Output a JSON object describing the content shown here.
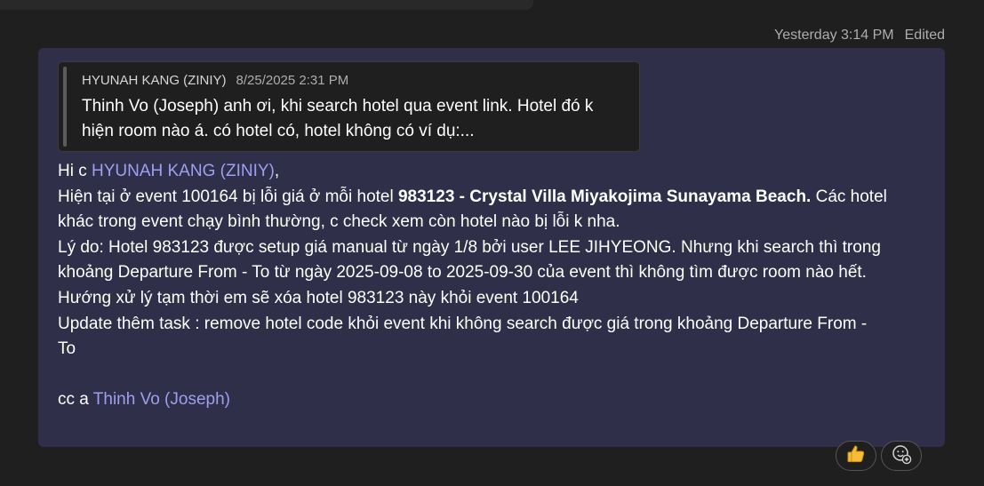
{
  "header": {
    "timestamp": "Yesterday 3:14 PM",
    "edited": "Edited"
  },
  "quote": {
    "author": "HYUNAH KANG (ZINIY)",
    "time": "8/25/2025 2:31 PM",
    "text_line1": "Thinh Vo (Joseph) anh ơi, khi search hotel qua event link. Hotel đó k",
    "text_line2": "hiện room nào á. có hotel có, hotel không có ví dụ:..."
  },
  "message": {
    "greeting_prefix": "Hi c ",
    "greeting_mention": "HYUNAH KANG (ZINIY)",
    "greeting_suffix": ",",
    "l2_text": "Hiện tại ở event 100164 bị lỗi giá ở mỗi hotel ",
    "l2_bold": "983123 - Crystal Villa Miyakojima Sunayama Beach.",
    "l2_rest": " Các hotel",
    "l3": "khác trong event chạy bình thường, c check xem còn hotel nào bị lỗi k nha.",
    "l4": "Lý do: Hotel 983123 được setup giá manual từ ngày 1/8 bởi user LEE JIHYEONG. Nhưng khi search thì trong",
    "l5": "khoảng Departure From - To từ ngày 2025-09-08 to 2025-09-30 của event thì không tìm được room nào hết.",
    "l6": "Hướng xử lý tạm thời em sẽ xóa hotel 983123 này khỏi event 100164",
    "l7": "Update thêm task : remove hotel code khỏi event khi không search được giá trong khoảng Departure From -",
    "l8": "To",
    "cc_prefix": "cc a ",
    "cc_mention": "Thinh Vo (Joseph)"
  },
  "reactions": {
    "like_icon": "thumbs-up-icon",
    "add_icon": "add-reaction-icon"
  },
  "colors": {
    "bubble": "#2f2f4a",
    "mention": "#9f9ff0",
    "background": "#1f1f1f"
  }
}
